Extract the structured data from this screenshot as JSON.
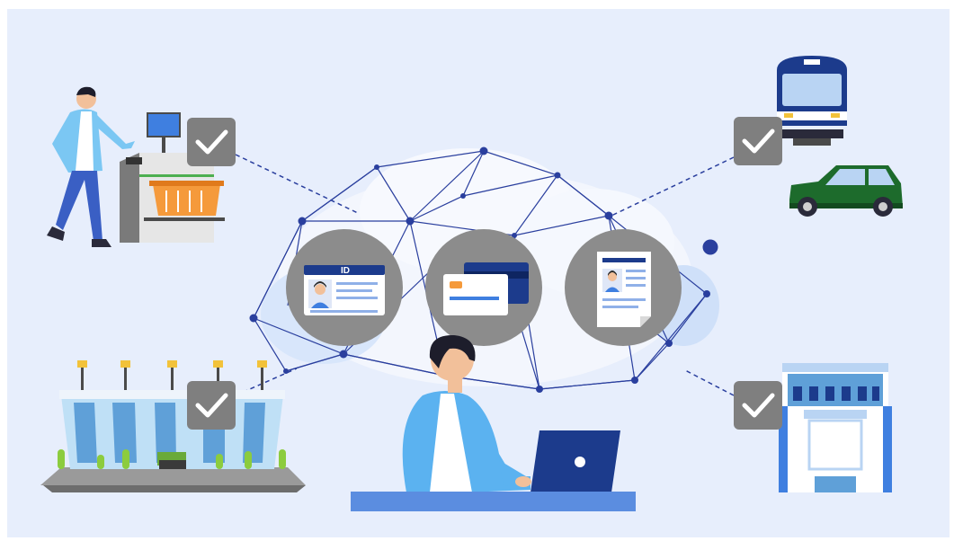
{
  "id_card": {
    "label": "ID"
  },
  "colors": {
    "background": "#e7eefc",
    "network": "#2a3f9e",
    "circle": "#8c8c8c",
    "check_box": "#7f7f7f",
    "accent_blue": "#3f7fe0",
    "train": "#1c3b8c",
    "car": "#1d6b2c",
    "basket": "#f59a3b"
  },
  "icons": [
    "self-checkout-icon",
    "train-icon",
    "car-icon",
    "stadium-icon",
    "office-building-icon",
    "id-card-icon",
    "credit-card-icon",
    "document-icon",
    "laptop-icon",
    "checkmark-icon"
  ]
}
